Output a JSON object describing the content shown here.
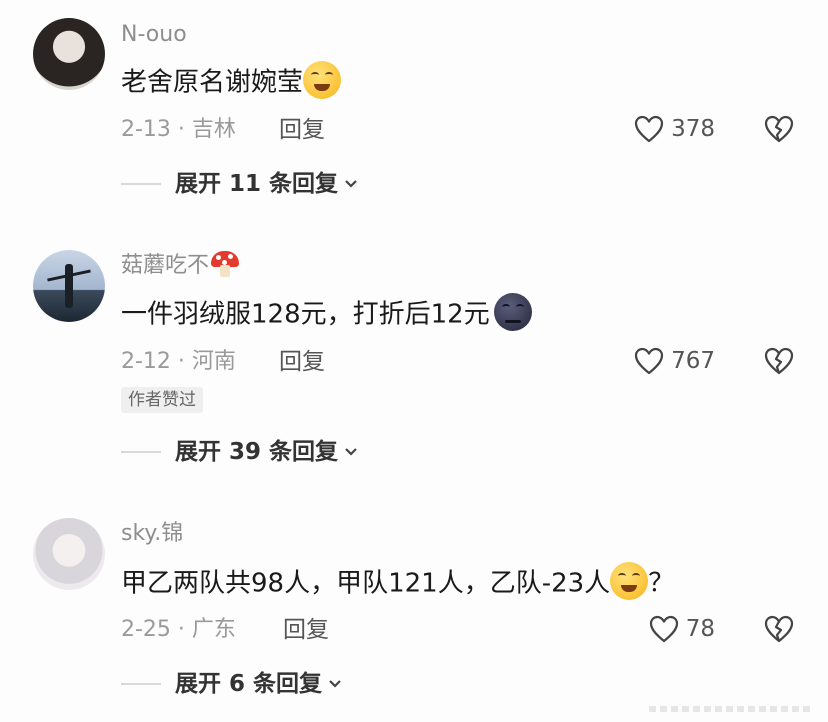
{
  "comments": [
    {
      "username": "N-ouo",
      "text": "老舍原名谢婉莹",
      "emoji": "smirk-face-emoji",
      "date_location": "2-13 · 吉林",
      "reply_label": "回复",
      "likes": "378",
      "expand_label": "展开 11 条回复"
    },
    {
      "username": "菇蘑吃不",
      "username_emoji": "mushroom-emoji",
      "text": "一件羽绒服128元，打折后12元",
      "emoji": "new-moon-face-emoji",
      "date_location": "2-12 · 河南",
      "reply_label": "回复",
      "likes": "767",
      "badge": "作者赞过",
      "expand_label": "展开 39 条回复"
    },
    {
      "username": "sky.锦",
      "text": "甲乙两队共98人，甲队121人，乙队-23人",
      "text_suffix": "？",
      "emoji": "grinning-sweat-emoji",
      "date_location": "2-25 · 广东",
      "reply_label": "回复",
      "likes": "78",
      "expand_label": "展开 6 条回复"
    }
  ],
  "colors": {
    "text": "#1a1a1a",
    "meta": "#9a9a9a",
    "username": "#8e8e8e",
    "background": "#fdfdfd"
  }
}
